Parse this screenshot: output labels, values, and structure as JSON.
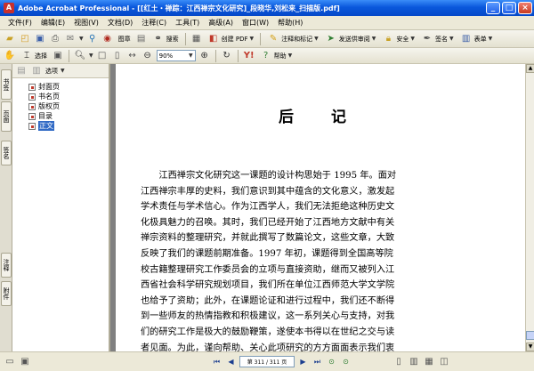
{
  "window": {
    "app_icon": "A",
    "title": "Adobe Acrobat Professional - [[红土・禅踪：江西禅宗文化研究]_段晓华,刘松来_扫描版.pdf]"
  },
  "menu": [
    "文件(F)",
    "编辑(E)",
    "视图(V)",
    "文档(D)",
    "注释(C)",
    "工具(T)",
    "高级(A)",
    "窗口(W)",
    "帮助(H)"
  ],
  "toolbar1": {
    "b1": "搜索",
    "b2": "创建 PDF",
    "b3": "注释和标记",
    "b4": "发送供审阅",
    "b5": "安全",
    "b6": "签名",
    "b7": "表单",
    "b8": "图章"
  },
  "toolbar2": {
    "select": "选择",
    "zoom": "90%",
    "help": "帮助"
  },
  "side_tabs": [
    "书签",
    "页面",
    "签名",
    "注释",
    "附件"
  ],
  "bookmarks": {
    "options": "选项",
    "items": [
      {
        "label": "封面页"
      },
      {
        "label": "书名页"
      },
      {
        "label": "版权页"
      },
      {
        "label": "目录"
      },
      {
        "label": "正文"
      }
    ]
  },
  "document": {
    "heading": "后 记",
    "lines": [
      "江西禅宗文化研究这一课题的设计构思始于 1995 年。面对",
      "江西禅宗丰厚的史料，我们意识到其中蕴含的文化意义，激发起",
      "学术责任与学术信心。作为江西学人，我们无法拒绝这种历史文",
      "化极具魅力的召唤。其时，我们已经开始了江西地方文献中有关",
      "禅宗资料的整理研究，并就此撰写了数篇论文，这些文章，大致",
      "反映了我们的课题前期准备。1997 年初，课题得到全国高等院",
      "校古籍整理研究工作委员会的立项与直接资助，继而又被列入江",
      "西省社会科学研究规划项目，我们所在单位江西师范大学文学院",
      "也给予了资助；此外，在课题论证和进行过程中，我们还不断得",
      "到一些师友的热情指教和积极建议，这一系列关心与支持，对我",
      "们的研究工作是极大的鼓励鞭策，遂使本书得以在世纪之交与读",
      "者见面。为此，谨向帮助、关心此项研究的方方面面表示我们衷"
    ]
  },
  "status": {
    "page_indicator": "第 311 / 311 页"
  }
}
